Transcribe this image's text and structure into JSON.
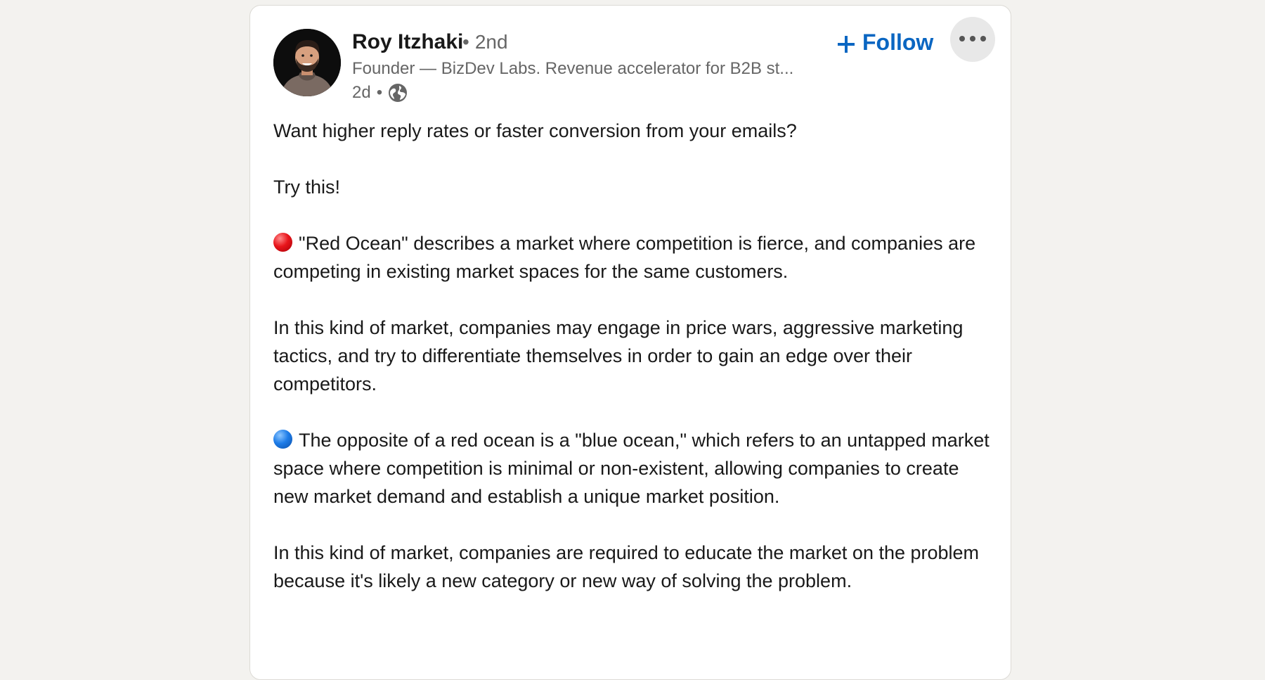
{
  "post": {
    "author": {
      "name": "Roy Itzhaki",
      "degree_separator": "•",
      "degree": "2nd",
      "headline": "Founder — BizDev Labs. Revenue accelerator for B2B st...",
      "time": "2d",
      "meta_separator": "•",
      "visibility_icon": "globe-icon"
    },
    "follow_label": "Follow",
    "follow_icon": "plus-icon",
    "more_icon": "more-options-icon",
    "accent_color": "#0a66c2",
    "paragraphs": {
      "p1": "Want higher reply rates or faster conversion from your emails?",
      "p2": "Try this!",
      "p3": "\"Red Ocean\" describes a market where competition is fierce, and companies are competing in existing market spaces for the same customers.",
      "p4": "In this kind of market, companies may engage in price wars, aggressive marketing tactics, and try to differentiate themselves in order to gain an edge over their competitors.",
      "p5": "The opposite of a red ocean is a \"blue ocean,\" which refers to an untapped market space where competition is minimal or non-existent, allowing companies to create new market demand and establish a unique market position.",
      "p6": "In this kind of market, companies are required to educate the market on the problem because it's likely a new category or new way of solving the problem."
    },
    "emojis": {
      "p3": "red-circle-emoji",
      "p5": "blue-circle-emoji"
    }
  }
}
